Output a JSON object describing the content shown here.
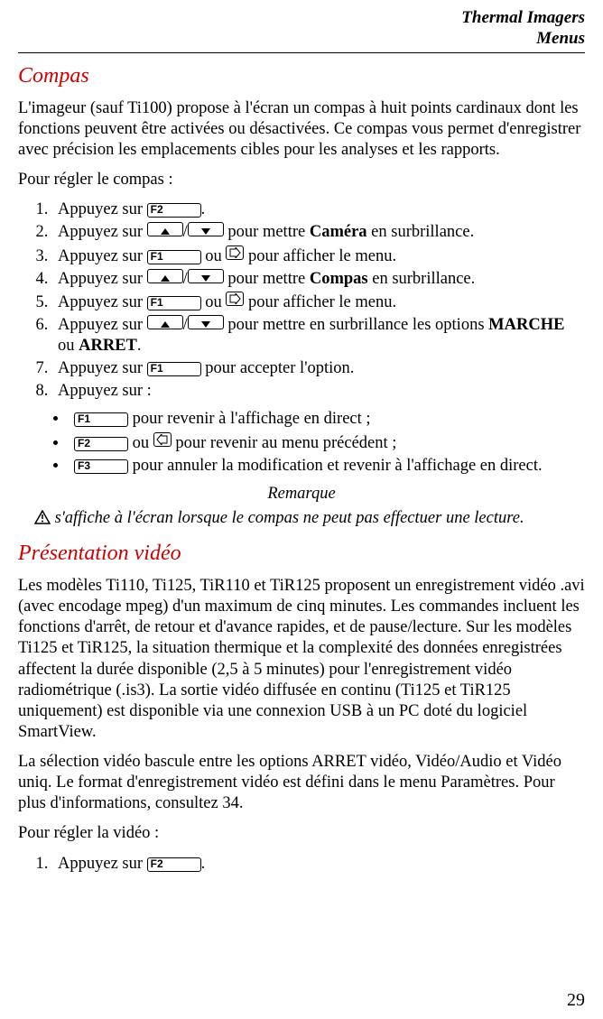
{
  "header": {
    "title": "Thermal Imagers",
    "subtitle": "Menus"
  },
  "keys": {
    "F1": "F1",
    "F2": "F2",
    "F3": "F3"
  },
  "compas": {
    "heading": "Compas",
    "intro": "L'imageur (sauf Ti100) propose à l'écran un compas à huit points cardinaux dont les fonctions peuvent être activées ou désactivées. Ce compas vous permet d'enregistrer avec précision les emplacements cibles pour les analyses et les rapports.",
    "prompt": "Pour régler le compas :",
    "steps": {
      "s1a": "Appuyez sur ",
      "s1b": ".",
      "s2a": "Appuyez sur ",
      "s2b": "/",
      "s2c": " pour mettre ",
      "s2d": "Caméra",
      "s2e": " en surbrillance.",
      "s3a": "Appuyez sur ",
      "s3b": " ou ",
      "s3c": " pour afficher le menu.",
      "s4a": "Appuyez sur ",
      "s4b": "/",
      "s4c": " pour mettre ",
      "s4d": "Compas",
      "s4e": " en surbrillance.",
      "s5a": "Appuyez sur ",
      "s5b": " ou ",
      "s5c": " pour afficher le menu.",
      "s6a": "Appuyez sur ",
      "s6b": "/",
      "s6c": " pour mettre en surbrillance les options ",
      "s6d": "MARCHE",
      "s6e": " ou ",
      "s6f": "ARRET",
      "s6g": ".",
      "s7a": "Appuyez sur ",
      "s7b": " pour accepter l'option.",
      "s8": "Appuyez sur :"
    },
    "bullets": {
      "b1a": " pour revenir à l'affichage en direct ;",
      "b2a": " ou ",
      "b2b": " pour revenir au menu précédent ;",
      "b3a": " pour annuler la modification et revenir à l'affichage en direct."
    },
    "remarque_label": "Remarque",
    "remarque_text": " s'affiche à l'écran lorsque le compas ne peut pas effectuer une lecture."
  },
  "video": {
    "heading": "Présentation vidéo",
    "para1": "Les modèles Ti110, Ti125, TiR110 et TiR125 proposent un enregistrement vidéo .avi (avec encodage mpeg) d'un maximum de cinq minutes. Les commandes incluent les fonctions d'arrêt, de retour et d'avance rapides, et de pause/lecture. Sur les modèles Ti125 et TiR125, la situation thermique et la complexité des données enregistrées affectent la durée disponible (2,5 à 5 minutes) pour l'enregistrement vidéo radiométrique (.is3). La sortie vidéo diffusée en continu (Ti125 et TiR125 uniquement) est disponible via une connexion USB à un PC doté du logiciel SmartView.",
    "para2": "La sélection vidéo bascule entre les options ARRET vidéo, Vidéo/Audio et Vidéo uniq. Le format d'enregistrement vidéo est défini dans le menu Paramètres. Pour plus d'informations, consultez 34.",
    "prompt": "Pour régler la vidéo :",
    "step1a": "Appuyez sur ",
    "step1b": "."
  },
  "page_number": "29"
}
